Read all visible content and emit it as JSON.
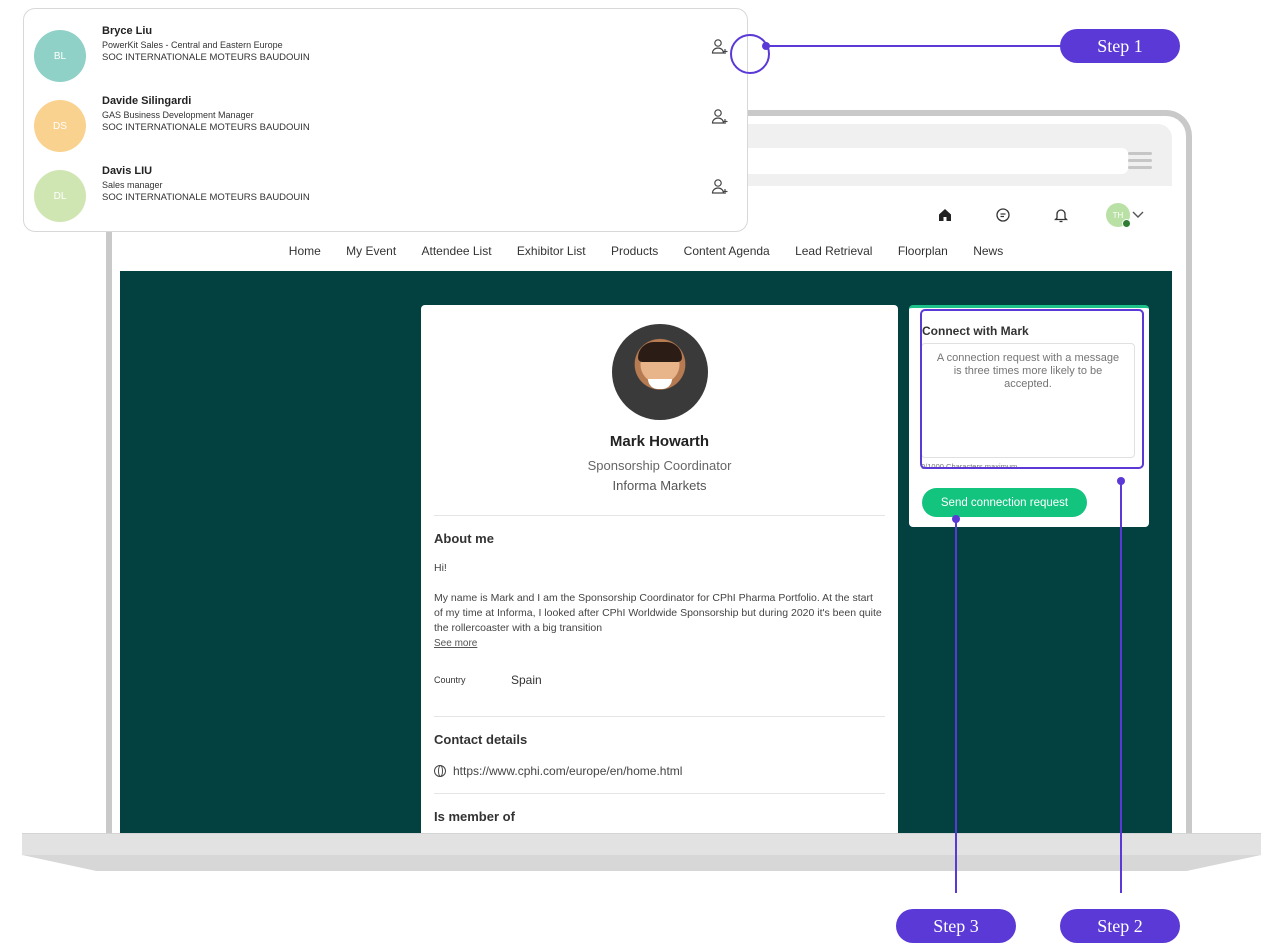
{
  "dropdown": {
    "people": [
      {
        "initials": "BL",
        "name": "Bryce Liu",
        "title": "PowerKit Sales - Central and Eastern Europe",
        "company": "SOC INTERNATIONALE MOTEURS BAUDOUIN",
        "avatar_color": "#8fd1c7"
      },
      {
        "initials": "DS",
        "name": "Davide Silingardi",
        "title": "GAS Business Development Manager",
        "company": "SOC INTERNATIONALE MOTEURS BAUDOUIN",
        "avatar_color": "#f9d28f"
      },
      {
        "initials": "DL",
        "name": "Davis LIU",
        "title": "Sales manager",
        "company": "SOC INTERNATIONALE MOTEURS BAUDOUIN",
        "avatar_color": "#cfe6b3"
      }
    ]
  },
  "header": {
    "user_initials": "TH",
    "nav": [
      "Home",
      "My Event",
      "Attendee List",
      "Exhibitor List",
      "Products",
      "Content Agenda",
      "Lead Retrieval",
      "Floorplan",
      "News"
    ]
  },
  "profile": {
    "name": "Mark Howarth",
    "role": "Sponsorship Coordinator",
    "company": "Informa Markets",
    "about_title": "About me",
    "about_greeting": "Hi!",
    "about_text": "My name is Mark and I am the Sponsorship Coordinator for CPhI Pharma Portfolio. At the start of my time at Informa, I looked after CPhI Worldwide Sponsorship but during 2020 it's been quite the rollercoaster with a big transition",
    "see_more": "See more",
    "country_label": "Country",
    "country_value": "Spain",
    "contact_title": "Contact details",
    "website": "https://www.cphi.com/europe/en/home.html",
    "member_title": "Is member of"
  },
  "connect": {
    "title": "Connect with Mark",
    "placeholder": "A connection request with a message is three times more likely to be accepted.",
    "char_count": "0/1000 Characters maximum",
    "send_label": "Send connection request"
  },
  "annotations": {
    "step1": "Step 1",
    "step2": "Step 2",
    "step3": "Step 3"
  },
  "colors": {
    "accent": "#5a39d6",
    "teal_background": "#034040",
    "button_green": "#13c47f"
  }
}
